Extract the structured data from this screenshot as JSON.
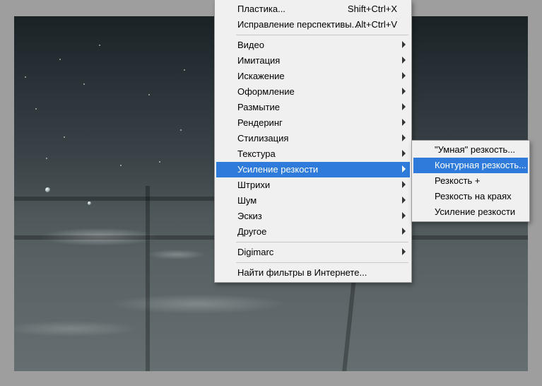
{
  "menu": {
    "top": [
      {
        "label": "Пластика...",
        "shortcut": "Shift+Ctrl+X"
      },
      {
        "label": "Исправление перспективы...",
        "shortcut": "Alt+Ctrl+V"
      }
    ],
    "group1": [
      {
        "label": "Видео"
      },
      {
        "label": "Имитация"
      },
      {
        "label": "Искажение"
      },
      {
        "label": "Оформление"
      },
      {
        "label": "Размытие"
      },
      {
        "label": "Рендеринг"
      },
      {
        "label": "Стилизация"
      },
      {
        "label": "Текстура"
      },
      {
        "label": "Усиление резкости",
        "highlight": true
      },
      {
        "label": "Штрихи"
      },
      {
        "label": "Шум"
      },
      {
        "label": "Эскиз"
      },
      {
        "label": "Другое"
      }
    ],
    "group2": [
      {
        "label": "Digimarc"
      }
    ],
    "group3": [
      {
        "label": "Найти фильтры в Интернете..."
      }
    ]
  },
  "submenu": [
    {
      "label": "\"Умная\" резкость..."
    },
    {
      "label": "Контурная резкость...",
      "highlight": true
    },
    {
      "label": "Резкость +"
    },
    {
      "label": "Резкость на краях"
    },
    {
      "label": "Усиление резкости"
    }
  ]
}
